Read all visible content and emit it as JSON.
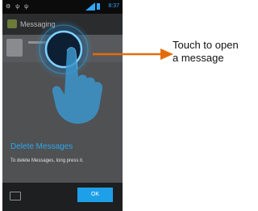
{
  "status_bar": {
    "time": "8:37"
  },
  "app_bar": {
    "title": "Messaging"
  },
  "tutorial": {
    "title": "Delete Messages",
    "body": "To delete Messages, long press it.",
    "ok_label": "OK"
  },
  "annotation": {
    "line1": "Touch to open",
    "line2": "a message",
    "arrow_color": "#e36c0a"
  },
  "colors": {
    "accent": "#1ea0e8",
    "hint_title": "#2aa7ee"
  }
}
